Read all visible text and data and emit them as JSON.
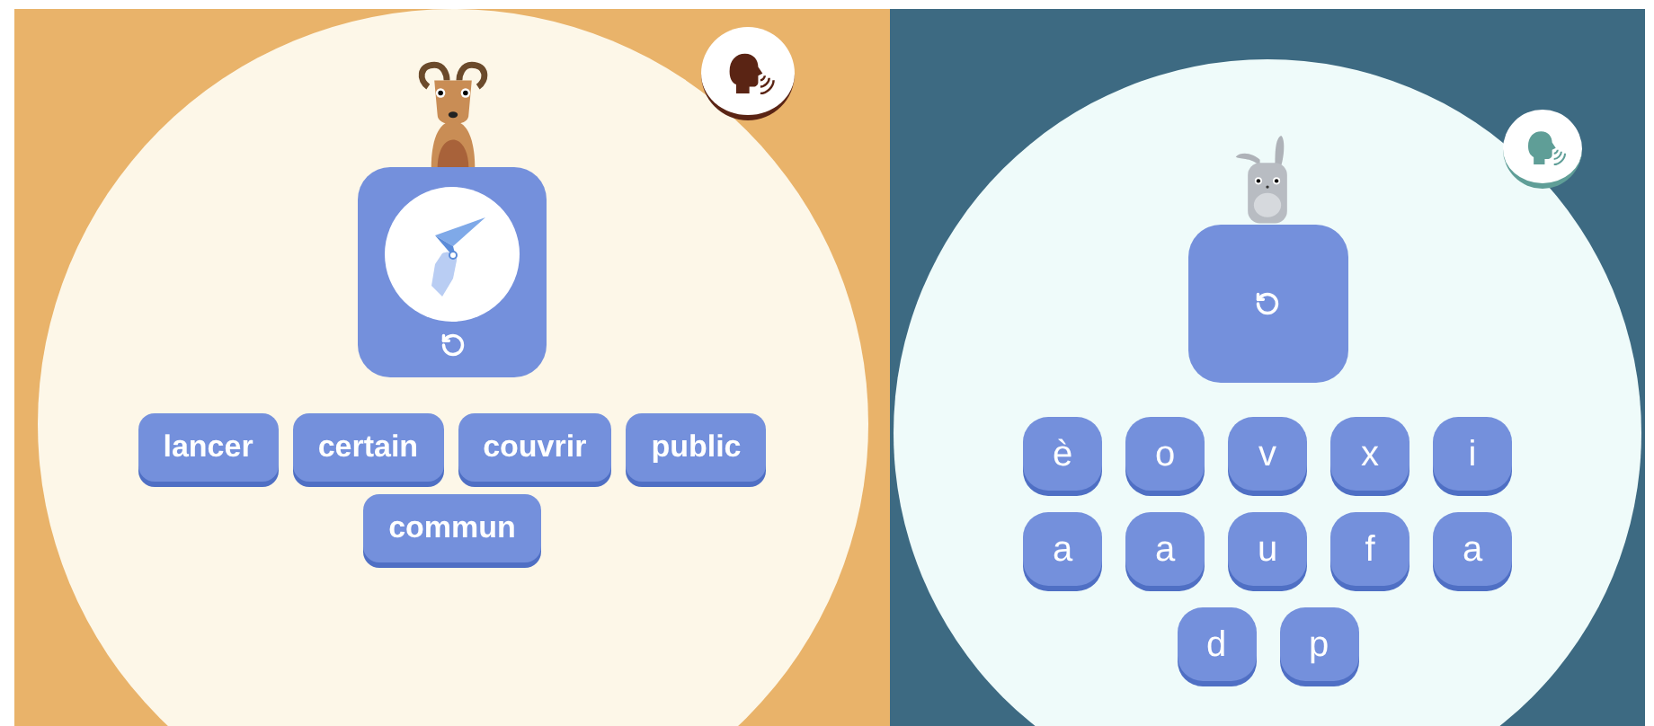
{
  "panels": [
    {
      "kind": "words",
      "choices": [
        {
          "label": "lancer"
        },
        {
          "label": "certain"
        },
        {
          "label": "couvrir"
        },
        {
          "label": "public"
        },
        {
          "label": "commun"
        }
      ]
    },
    {
      "kind": "letters",
      "choices": [
        {
          "label": "è"
        },
        {
          "label": "o"
        },
        {
          "label": "v"
        },
        {
          "label": "x"
        },
        {
          "label": "i"
        },
        {
          "label": "a"
        },
        {
          "label": "a"
        },
        {
          "label": "u"
        },
        {
          "label": "f"
        },
        {
          "label": "a"
        },
        {
          "label": "d"
        },
        {
          "label": "p"
        }
      ]
    }
  ]
}
